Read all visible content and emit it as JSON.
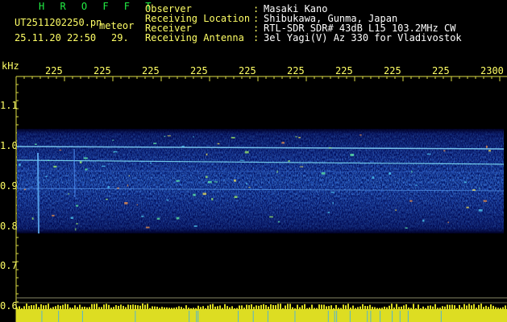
{
  "header": {
    "brand": "H R O F F T",
    "filename": "UT2511202250.pn",
    "suffix": "meteor",
    "datetime": "25.11.20 22:50",
    "count": "29."
  },
  "info": [
    {
      "label": "Observer",
      "value": "Masaki Kano"
    },
    {
      "label": "Receiving Location",
      "value": "Shibukawa, Gunma, Japan"
    },
    {
      "label": "Receiver",
      "value": "RTL-SDR SDR# 43dB L15 103.2MHz CW"
    },
    {
      "label": "Receiving Antenna",
      "value": "3el Yagi(V) Az 330 for Vladivostok"
    }
  ],
  "axes": {
    "y_unit": "kHz",
    "y_ticks": [
      "1.1",
      "1.0",
      "0.9",
      "0.8",
      "0.7",
      "0.6"
    ],
    "x_ticks": [
      "225",
      "225",
      "225",
      "225",
      "225",
      "225",
      "225",
      "225",
      "225",
      "2300"
    ]
  },
  "colors": {
    "label": "#ffff66",
    "value": "#ffffff",
    "brand": "#22ee44",
    "grid": "#dddd44",
    "background": "#000000"
  }
}
